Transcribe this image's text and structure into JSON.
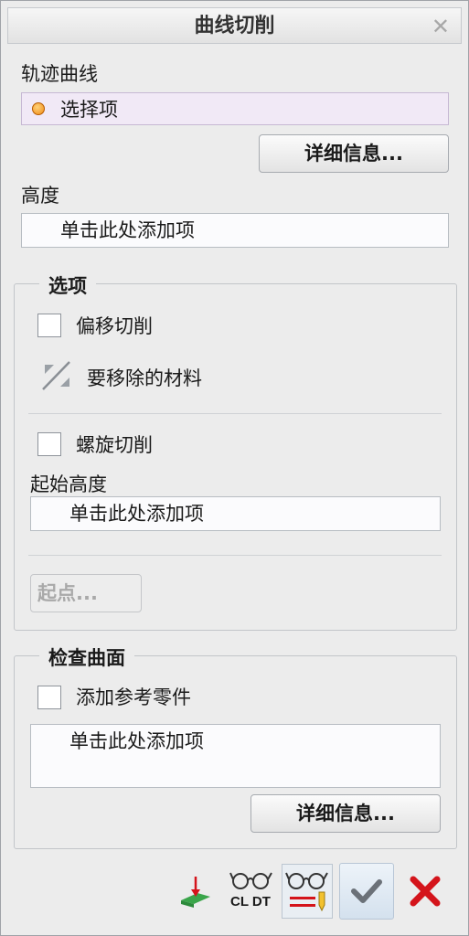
{
  "dialog": {
    "title": "曲线切削",
    "close_icon": "close-icon"
  },
  "trajectory": {
    "label": "轨迹曲线",
    "value": "选择项",
    "details_button": "详细信息..."
  },
  "height": {
    "label": "高度",
    "placeholder": "单击此处添加项"
  },
  "options": {
    "title": "选项",
    "offset_cut_label": "偏移切削",
    "offset_cut_checked": false,
    "material_removal_label": "要移除的材料",
    "helical_cut_label": "螺旋切削",
    "helical_cut_checked": false,
    "start_height_label": "起始高度",
    "start_height_placeholder": "单击此处添加项",
    "start_point_button": "起点..."
  },
  "check_surfaces": {
    "title": "检查曲面",
    "add_ref_parts_label": "添加参考零件",
    "add_ref_parts_checked": false,
    "list_placeholder": "单击此处添加项",
    "details_button": "详细信息..."
  },
  "toolbar": {
    "cl_dt_label": "CL DT",
    "colors": {
      "accent_green": "#3aa54a",
      "cancel_red": "#d4141b",
      "confirm_gray": "#6b7178"
    }
  }
}
